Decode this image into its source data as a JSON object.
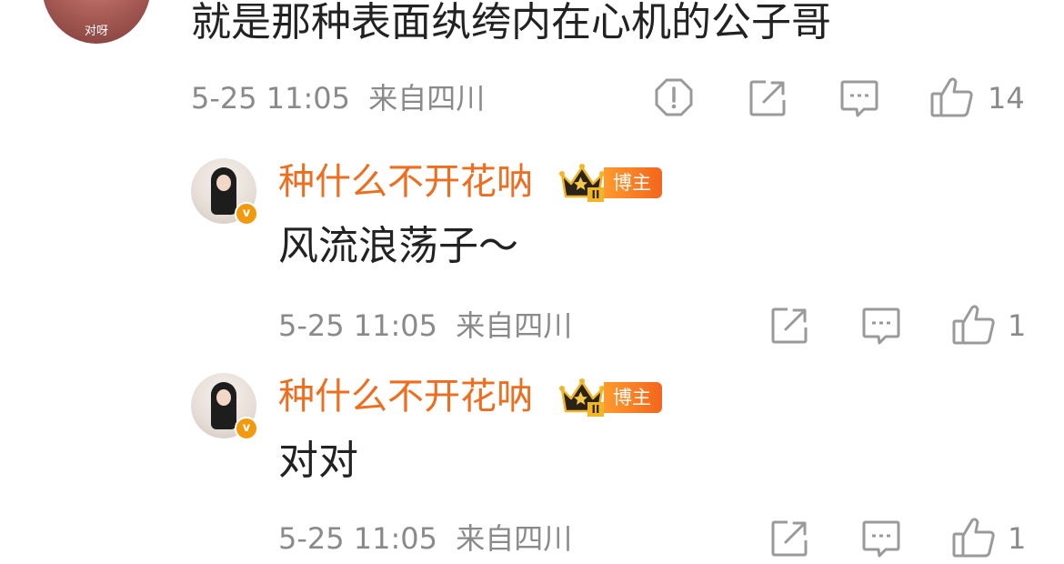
{
  "top_comment": {
    "avatar_caption": "对呀",
    "text": "就是那种表面纨绔内在心机的公子哥",
    "time": "5-25 11:05",
    "location": "来自四川",
    "likes": "14"
  },
  "replies": [
    {
      "username": "种什么不开花呐",
      "badge": "博主",
      "crown_level": "II",
      "verified_mark": "v",
      "text": "风流浪荡子～",
      "time": "5-25 11:05",
      "location": "来自四川",
      "likes": "1"
    },
    {
      "username": "种什么不开花呐",
      "badge": "博主",
      "crown_level": "II",
      "verified_mark": "v",
      "text": "对对",
      "time": "5-25 11:05",
      "location": "来自四川",
      "likes": "1"
    }
  ],
  "colors": {
    "username": "#ef6d1f",
    "meta": "#8a8a8a",
    "icon": "#9a9a9a"
  },
  "icons": [
    "report-icon",
    "share-icon",
    "comment-icon",
    "like-icon",
    "crown-icon",
    "verified-icon"
  ]
}
